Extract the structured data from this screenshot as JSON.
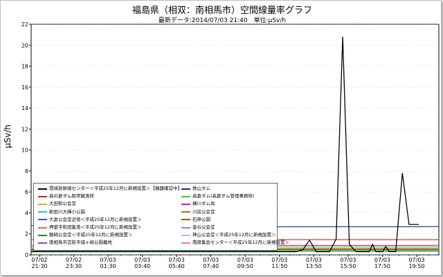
{
  "title": "福島県（相双：南相馬市）空間線量率グラフ",
  "subtitle": "最新データ:2014/07/03 21:40　単位:μSv/h",
  "chart_data": {
    "type": "line",
    "ylabel": "μSv/h",
    "ylim": [
      0,
      22
    ],
    "y_ticks": [
      0,
      2,
      4,
      6,
      8,
      10,
      12,
      14,
      16,
      18,
      20,
      22
    ],
    "x_ticks": [
      {
        "date": "07/02",
        "time": "21:30"
      },
      {
        "date": "07/02",
        "time": "23:30"
      },
      {
        "date": "07/03",
        "time": "01:30"
      },
      {
        "date": "07/03",
        "time": "03:40"
      },
      {
        "date": "07/03",
        "time": "05:40"
      },
      {
        "date": "07/03",
        "time": "07:40"
      },
      {
        "date": "07/03",
        "time": "09:50"
      },
      {
        "date": "07/03",
        "time": "11:50"
      },
      {
        "date": "07/03",
        "time": "13:50"
      },
      {
        "date": "07/03",
        "time": "15:50"
      },
      {
        "date": "07/03",
        "time": "17:50"
      },
      {
        "date": "07/03",
        "time": "19:50"
      }
    ],
    "series": [
      {
        "name": "環境放射線センター＜平成25年12月に新規設置＞【機器確認中】",
        "color": "#000000"
      },
      {
        "name": "鉄山ダム",
        "color": "#1e2a8c"
      },
      {
        "name": "高の倉ダム助常観測所",
        "color": "#d62020"
      },
      {
        "name": "高倉ダム(高倉ダム管理事務所)",
        "color": "#3cc83c"
      },
      {
        "name": "大田和公会堂",
        "color": "#f0a020"
      },
      {
        "name": "横川ダム局",
        "color": "#c020c0"
      },
      {
        "name": "新田川大輝小公園",
        "color": "#20c8c8"
      },
      {
        "name": "川房公会堂",
        "color": "#808020"
      },
      {
        "name": "大倉公会堂近傍＜平成25年12月に新規設置＞",
        "color": "#4040ff"
      },
      {
        "name": "石神公園",
        "color": "#a05020"
      },
      {
        "name": "押釜字萩田集落＜平成25年12月に新規設置＞",
        "color": "#e07030"
      },
      {
        "name": "金谷公会堂",
        "color": "#8080ff"
      },
      {
        "name": "飯崎公会堂＜平成25年12月に新規設置＞",
        "color": "#208040"
      },
      {
        "name": "神山公会堂＜平成25年12月に新規設置＞",
        "color": "#c0c0c0"
      },
      {
        "name": "南相馬市営萩平城ヶ崎公園墓地",
        "color": "#a040a0"
      },
      {
        "name": "南原集会センター＜平成25年12月に新規設置＞",
        "color": "#f08080"
      }
    ],
    "plotted": [
      {
        "color": "#1e2a8c",
        "points": [
          [
            0,
            2.8
          ],
          [
            10,
            2.75
          ],
          [
            15,
            2.72
          ],
          [
            21,
            2.72
          ],
          [
            27,
            2.7
          ],
          [
            33,
            2.7
          ],
          [
            39,
            2.7
          ],
          [
            45,
            2.7
          ],
          [
            51,
            2.7
          ],
          [
            57,
            2.7
          ],
          [
            63,
            2.7
          ],
          [
            69,
            2.7
          ],
          [
            75,
            2.68
          ],
          [
            81,
            2.68
          ],
          [
            87,
            2.68
          ],
          [
            93,
            2.68
          ],
          [
            99,
            2.68
          ],
          [
            105,
            2.68
          ],
          [
            111,
            2.68
          ],
          [
            117,
            2.68
          ],
          [
            123,
            2.7
          ]
        ]
      },
      {
        "color": "#d62020",
        "points": [
          [
            0,
            1.45
          ],
          [
            123,
            1.45
          ]
        ]
      },
      {
        "color": "#3cc83c",
        "points": [
          [
            0,
            0.75
          ],
          [
            123,
            0.75
          ]
        ]
      },
      {
        "color": "#f0a020",
        "points": [
          [
            0,
            0.62
          ],
          [
            123,
            0.62
          ]
        ]
      },
      {
        "color": "#c020c0",
        "points": [
          [
            0,
            0.9
          ],
          [
            123,
            0.9
          ]
        ]
      },
      {
        "color": "#20c8c8",
        "points": [
          [
            0,
            0.4
          ],
          [
            123,
            0.4
          ]
        ]
      },
      {
        "color": "#808020",
        "points": [
          [
            0,
            0.55
          ],
          [
            123,
            0.55
          ]
        ]
      },
      {
        "color": "#a05020",
        "points": [
          [
            0,
            0.5
          ],
          [
            123,
            0.5
          ]
        ]
      },
      {
        "color": "#208040",
        "points": [
          [
            0,
            0.35
          ],
          [
            123,
            0.35
          ]
        ]
      },
      {
        "color": "#000000",
        "points": [
          [
            0,
            0.3
          ],
          [
            80,
            0.3
          ],
          [
            82,
            0.5
          ],
          [
            84,
            1.4
          ],
          [
            86,
            0.3
          ],
          [
            90,
            0.3
          ],
          [
            92,
            1.5
          ],
          [
            94,
            20.8
          ],
          [
            96,
            1.0
          ],
          [
            98,
            0.3
          ],
          [
            102,
            0.3
          ],
          [
            103,
            1.0
          ],
          [
            104,
            0.3
          ],
          [
            106,
            0.3
          ],
          [
            107,
            0.8
          ],
          [
            108,
            0.3
          ],
          [
            110,
            0.3
          ],
          [
            112,
            7.8
          ],
          [
            114,
            2.9
          ],
          [
            117,
            2.9
          ]
        ]
      }
    ]
  }
}
